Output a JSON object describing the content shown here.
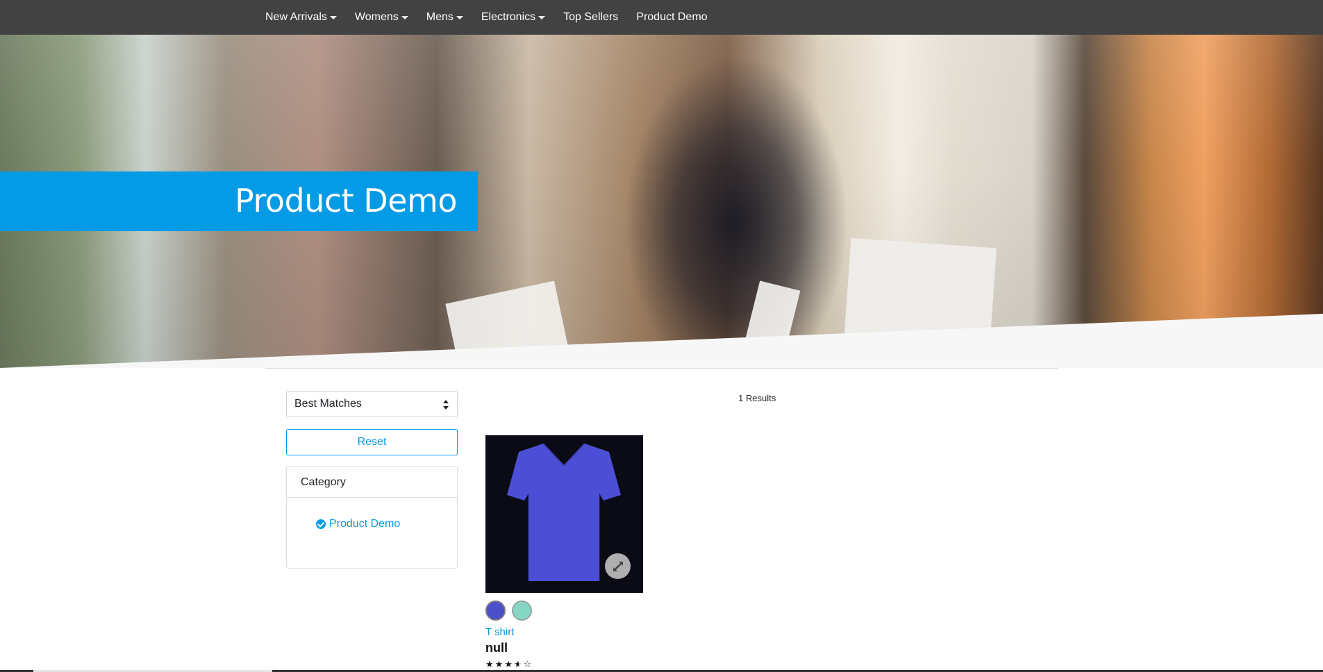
{
  "nav": {
    "items": [
      {
        "label": "New Arrivals",
        "dropdown": true
      },
      {
        "label": "Womens",
        "dropdown": true
      },
      {
        "label": "Mens",
        "dropdown": true
      },
      {
        "label": "Electronics",
        "dropdown": true
      },
      {
        "label": "Top Sellers",
        "dropdown": false
      },
      {
        "label": "Product Demo",
        "dropdown": false
      }
    ]
  },
  "hero": {
    "title": "Product Demo",
    "banner_color": "#039be5"
  },
  "sidebar": {
    "sort_value": "Best Matches",
    "reset_label": "Reset",
    "category_title": "Category",
    "selected_category": "Product Demo"
  },
  "results": {
    "count_label": "1 Results",
    "products": [
      {
        "category": "T shirt",
        "name": "null",
        "rating": 3.5,
        "rating_max": 5,
        "swatches": [
          "#4b4fc9",
          "#86d6c4"
        ],
        "image_icon": "tshirt-image",
        "tshirt_color": "#4c4fd6"
      }
    ]
  },
  "colors": {
    "navbar": "#424242",
    "accent": "#039be5"
  }
}
